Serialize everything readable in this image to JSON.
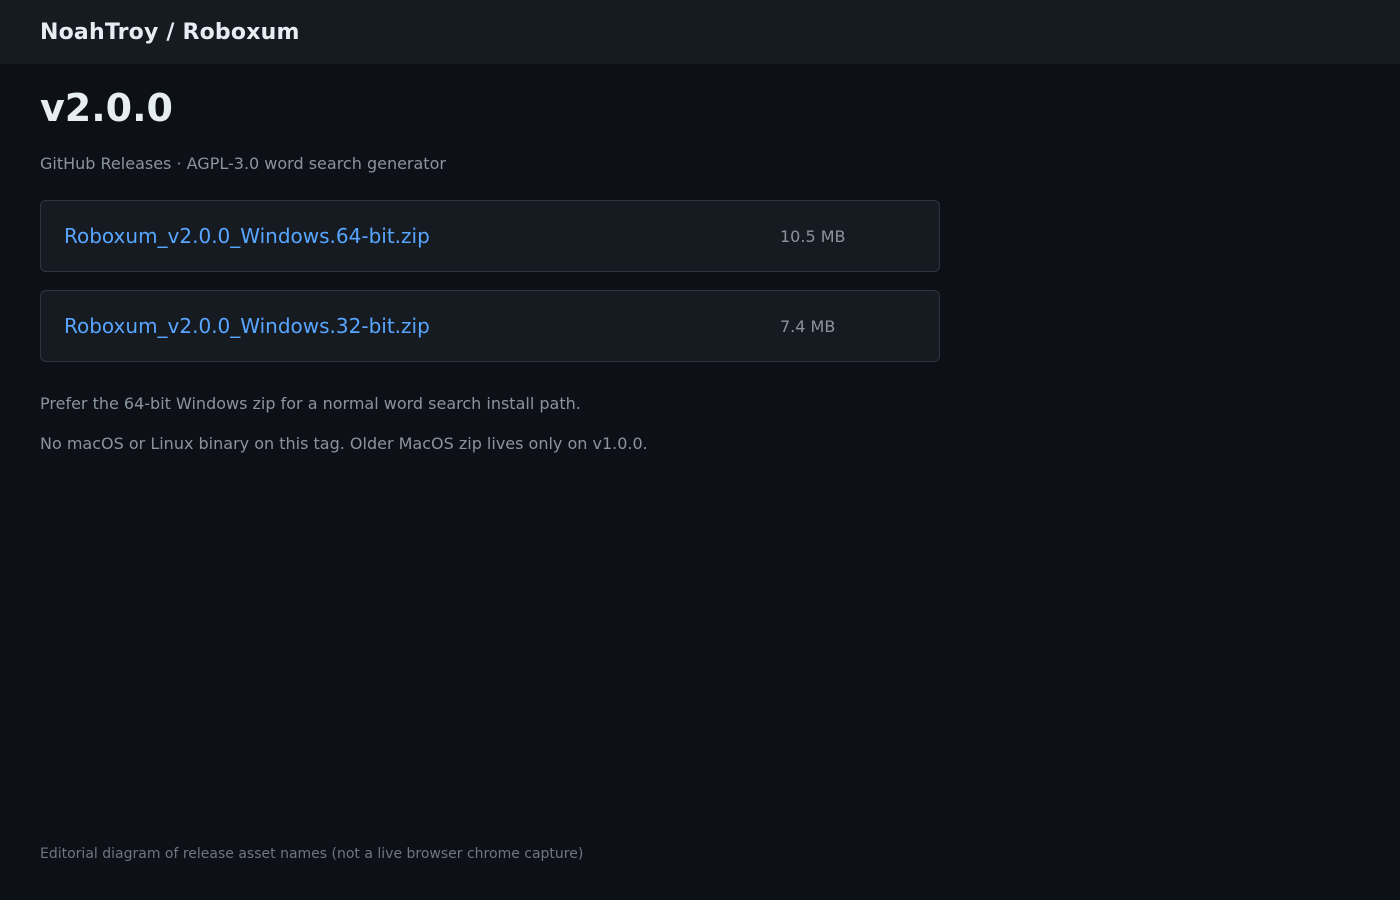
{
  "header": {
    "repo_path": "NoahTroy / Roboxum"
  },
  "release": {
    "title": "v2.0.0",
    "subtitle": "GitHub Releases · AGPL-3.0 word search generator"
  },
  "assets": [
    {
      "name": "Roboxum_v2.0.0_Windows.64-bit.zip",
      "size": "10.5 MB"
    },
    {
      "name": "Roboxum_v2.0.0_Windows.32-bit.zip",
      "size": "7.4 MB"
    }
  ],
  "notes": {
    "recommendation": "Prefer the 64-bit Windows zip for a normal word search install path.",
    "platform_note": "No macOS or Linux binary on this tag. Older MacOS zip lives only on v1.0.0."
  },
  "footer": {
    "caption": "Editorial diagram of release asset names (not a live browser chrome capture)"
  },
  "colors": {
    "background": "#0d1117",
    "header_bg": "#161b22",
    "link": "#58a6ff",
    "muted_text": "#8b949e"
  }
}
